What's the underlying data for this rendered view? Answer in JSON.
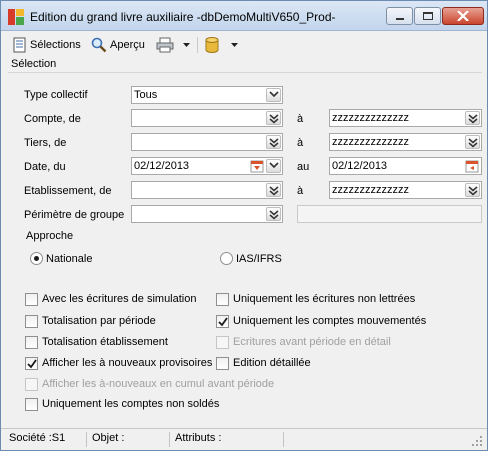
{
  "window": {
    "title": "Edition du grand livre auxiliaire -dbDemoMultiV650_Prod-"
  },
  "toolbar": {
    "selections_label": "Sélections",
    "apercu_label": "Aperçu"
  },
  "section": {
    "title": "Sélection"
  },
  "form": {
    "type_collectif_label": "Type collectif",
    "type_collectif_value": "Tous",
    "compte_label": "Compte, de",
    "compte_from": "",
    "compte_to_label": "à",
    "compte_to": "zzzzzzzzzzzzzz",
    "tiers_label": "Tiers, de",
    "tiers_from": "",
    "tiers_to_label": "à",
    "tiers_to": "zzzzzzzzzzzzzz",
    "date_label": "Date, du",
    "date_from": "02/12/2013",
    "date_to_label": "au",
    "date_to": "02/12/2013",
    "etab_label": "Etablissement, de",
    "etab_from": "",
    "etab_to_label": "à",
    "etab_to": "zzzzzzzzzzzzzz",
    "perimetre_label": "Périmètre de groupe",
    "perimetre_value": ""
  },
  "approche": {
    "label": "Approche",
    "nationale": "Nationale",
    "ias": "IAS/IFRS",
    "selected": "Nationale"
  },
  "options": {
    "simulation": {
      "label": "Avec les écritures de simulation",
      "checked": false,
      "enabled": true
    },
    "non_lettrees": {
      "label": "Uniquement les écritures non lettrées",
      "checked": false,
      "enabled": true
    },
    "totalisation_periode": {
      "label": "Totalisation par période",
      "checked": false,
      "enabled": true
    },
    "comptes_mouvementes": {
      "label": "Uniquement les comptes mouvementés",
      "checked": true,
      "enabled": true
    },
    "totalisation_etab": {
      "label": "Totalisation établissement",
      "checked": false,
      "enabled": true
    },
    "ecritures_avant": {
      "label": "Ecritures avant période en détail",
      "checked": false,
      "enabled": false
    },
    "a_nouveaux_provisoires": {
      "label": "Afficher les à nouveaux provisoires",
      "checked": true,
      "enabled": true
    },
    "edition_detaillee": {
      "label": "Edition détaillée",
      "checked": false,
      "enabled": true
    },
    "a_nouveaux_cumul": {
      "label": "Afficher les à-nouveaux en cumul avant période",
      "checked": false,
      "enabled": false
    },
    "non_soldes": {
      "label": "Uniquement les comptes non soldés",
      "checked": false,
      "enabled": true
    }
  },
  "status": {
    "societe": "Société :S1",
    "objet": "Objet :",
    "attributs": "Attributs :"
  },
  "colors": {
    "check": "#1a1a1a",
    "calendar_red": "#d9532c"
  }
}
